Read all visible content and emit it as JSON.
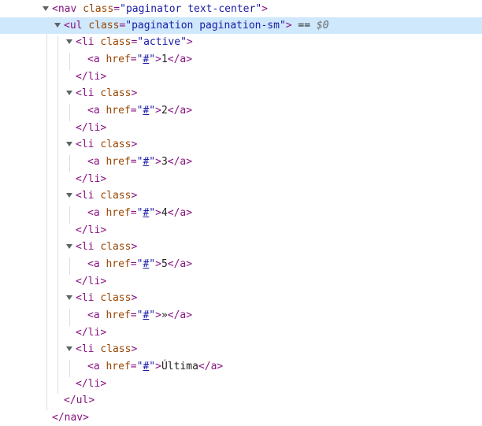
{
  "nav_open": {
    "tag": "nav",
    "attr": "class",
    "value": "paginator text-center"
  },
  "ul_open": {
    "tag": "ul",
    "attr": "class",
    "value": "pagination pagination-sm",
    "suffix": " == ",
    "console_ref": "$0"
  },
  "items": [
    {
      "li_attr": "class",
      "li_class": "active",
      "href_attr": "href",
      "href": "#",
      "text": "1"
    },
    {
      "li_attr": "class",
      "li_class": "",
      "href_attr": "href",
      "href": "#",
      "text": "2"
    },
    {
      "li_attr": "class",
      "li_class": "",
      "href_attr": "href",
      "href": "#",
      "text": "3"
    },
    {
      "li_attr": "class",
      "li_class": "",
      "href_attr": "href",
      "href": "#",
      "text": "4"
    },
    {
      "li_attr": "class",
      "li_class": "",
      "href_attr": "href",
      "href": "#",
      "text": "5"
    },
    {
      "li_attr": "class",
      "li_class": "",
      "href_attr": "href",
      "href": "#",
      "text": "»"
    },
    {
      "li_attr": "class",
      "li_class": "",
      "href_attr": "href",
      "href": "#",
      "text": "Última"
    }
  ],
  "tags": {
    "li": "li",
    "a": "a",
    "ul": "ul",
    "nav": "nav"
  },
  "colors": {
    "tag": "#881280",
    "attr_name": "#994500",
    "attr_value": "#1a1aa6",
    "selected_row": "#cfe8fc"
  }
}
